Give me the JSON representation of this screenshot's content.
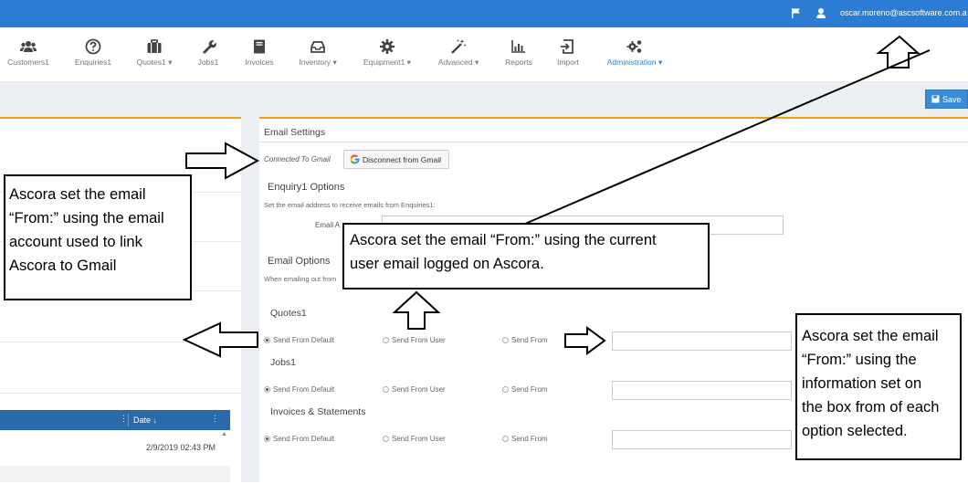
{
  "topbar": {
    "user_email": "oscar.moreno@ascsoftware.com.a"
  },
  "nav": {
    "items": [
      {
        "label": "Customers1",
        "icon": "users-icon"
      },
      {
        "label": "Enquiries1",
        "icon": "question-icon"
      },
      {
        "label": "Quotes1 ▾",
        "icon": "briefcase-icon"
      },
      {
        "label": "Jobs1",
        "icon": "wrench-icon"
      },
      {
        "label": "Invoices",
        "icon": "book-icon"
      },
      {
        "label": "Inventory ▾",
        "icon": "inbox-icon"
      },
      {
        "label": "Equipment1 ▾",
        "icon": "gear-icon"
      },
      {
        "label": "Advanced ▾",
        "icon": "magic-wand-icon"
      },
      {
        "label": "Reports",
        "icon": "bar-chart-icon"
      },
      {
        "label": "Import",
        "icon": "import-icon"
      },
      {
        "label": "Administration ▾",
        "icon": "gears-icon"
      }
    ]
  },
  "toolbar": {
    "save_label": "Save"
  },
  "grid": {
    "date_header": "Date",
    "sort_indicator": "↓",
    "row_date": "2/9/2019 02:43 PM"
  },
  "email_settings": {
    "title": "Email Settings",
    "connected_label": "Connected To Gmail",
    "disconnect_label": "Disconnect from Gmail",
    "enquiry_heading": "Enquiry1 Options",
    "enquiry_desc": "Set the email address to receive emails from Enquiries1:",
    "email_address_label": "Email A",
    "email_options_heading": "Email Options",
    "when_text": "When emailing out from",
    "sections": [
      {
        "title": "Quotes1",
        "opt_default": "Send From Default",
        "opt_user": "Send From User",
        "opt_from": "Send From"
      },
      {
        "title": "Jobs1",
        "opt_default": "Send From Default",
        "opt_user": "Send From User",
        "opt_from": "Send From"
      },
      {
        "title": "Invoices & Statements",
        "opt_default": "Send From Default",
        "opt_user": "Send From User",
        "opt_from": "Send From"
      }
    ]
  },
  "callouts": {
    "gmail": [
      "Ascora set the email",
      "“From:” using the email",
      "account used to link",
      "Ascora to Gmail"
    ],
    "current_user": [
      "Ascora set the email “From:” using the current",
      "user email logged on Ascora."
    ],
    "box_from": [
      "Ascora set the email",
      "“From:” using the",
      "information set on",
      "the box from of each",
      "option selected."
    ]
  },
  "colors": {
    "topbar": "#2b7cd3",
    "accent": "#f39c12",
    "grid_header": "#2b6aa8"
  }
}
